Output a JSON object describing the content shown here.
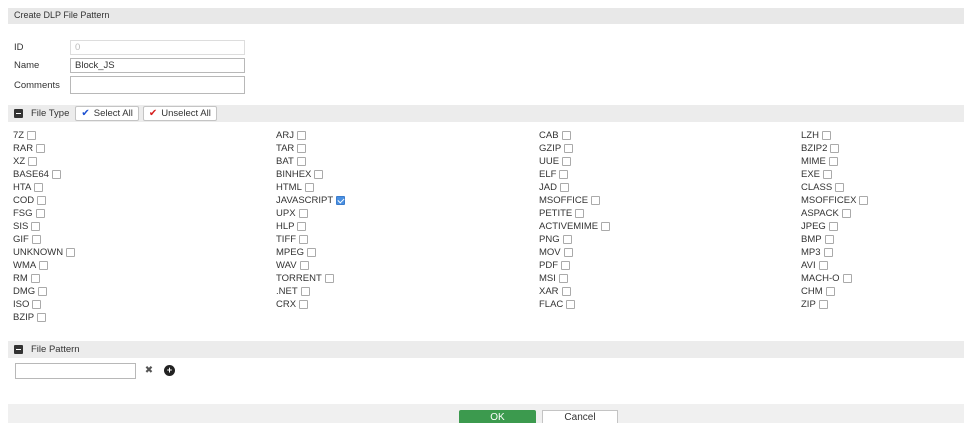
{
  "window": {
    "title": "Create DLP File Pattern"
  },
  "form": {
    "id_label": "ID",
    "id_value": "0",
    "name_label": "Name",
    "name_value": "Block_JS",
    "comments_label": "Comments",
    "comments_value": ""
  },
  "file_type": {
    "section_label": "File Type",
    "select_all_label": "Select All",
    "unselect_all_label": "Unselect All",
    "columns": [
      [
        {
          "label": "7Z",
          "checked": false
        },
        {
          "label": "RAR",
          "checked": false
        },
        {
          "label": "XZ",
          "checked": false
        },
        {
          "label": "BASE64",
          "checked": false
        },
        {
          "label": "HTA",
          "checked": false
        },
        {
          "label": "COD",
          "checked": false
        },
        {
          "label": "FSG",
          "checked": false
        },
        {
          "label": "SIS",
          "checked": false
        },
        {
          "label": "GIF",
          "checked": false
        },
        {
          "label": "UNKNOWN",
          "checked": false
        },
        {
          "label": "WMA",
          "checked": false
        },
        {
          "label": "RM",
          "checked": false
        },
        {
          "label": "DMG",
          "checked": false
        },
        {
          "label": "ISO",
          "checked": false
        },
        {
          "label": "BZIP",
          "checked": false
        }
      ],
      [
        {
          "label": "ARJ",
          "checked": false
        },
        {
          "label": "TAR",
          "checked": false
        },
        {
          "label": "BAT",
          "checked": false
        },
        {
          "label": "BINHEX",
          "checked": false
        },
        {
          "label": "HTML",
          "checked": false
        },
        {
          "label": "JAVASCRIPT",
          "checked": true
        },
        {
          "label": "UPX",
          "checked": false
        },
        {
          "label": "HLP",
          "checked": false
        },
        {
          "label": "TIFF",
          "checked": false
        },
        {
          "label": "MPEG",
          "checked": false
        },
        {
          "label": "WAV",
          "checked": false
        },
        {
          "label": "TORRENT",
          "checked": false
        },
        {
          "label": ".NET",
          "checked": false
        },
        {
          "label": "CRX",
          "checked": false
        }
      ],
      [
        {
          "label": "CAB",
          "checked": false
        },
        {
          "label": "GZIP",
          "checked": false
        },
        {
          "label": "UUE",
          "checked": false
        },
        {
          "label": "ELF",
          "checked": false
        },
        {
          "label": "JAD",
          "checked": false
        },
        {
          "label": "MSOFFICE",
          "checked": false
        },
        {
          "label": "PETITE",
          "checked": false
        },
        {
          "label": "ACTIVEMIME",
          "checked": false
        },
        {
          "label": "PNG",
          "checked": false
        },
        {
          "label": "MOV",
          "checked": false
        },
        {
          "label": "PDF",
          "checked": false
        },
        {
          "label": "MSI",
          "checked": false
        },
        {
          "label": "XAR",
          "checked": false
        },
        {
          "label": "FLAC",
          "checked": false
        }
      ],
      [
        {
          "label": "LZH",
          "checked": false
        },
        {
          "label": "BZIP2",
          "checked": false
        },
        {
          "label": "MIME",
          "checked": false
        },
        {
          "label": "EXE",
          "checked": false
        },
        {
          "label": "CLASS",
          "checked": false
        },
        {
          "label": "MSOFFICEX",
          "checked": false
        },
        {
          "label": "ASPACK",
          "checked": false
        },
        {
          "label": "JPEG",
          "checked": false
        },
        {
          "label": "BMP",
          "checked": false
        },
        {
          "label": "MP3",
          "checked": false
        },
        {
          "label": "AVI",
          "checked": false
        },
        {
          "label": "MACH-O",
          "checked": false
        },
        {
          "label": "CHM",
          "checked": false
        },
        {
          "label": "ZIP",
          "checked": false
        }
      ]
    ]
  },
  "file_pattern": {
    "section_label": "File Pattern",
    "value": "",
    "remove_icon": "close-icon",
    "add_icon": "plus-circle-icon"
  },
  "footer": {
    "ok_label": "OK",
    "cancel_label": "Cancel"
  },
  "colors": {
    "ok_button": "#3c9a4e",
    "checkbox_checked": "#4a90e2",
    "select_all_check": "#1b4fd1",
    "unselect_all_check": "#d61f1f"
  }
}
